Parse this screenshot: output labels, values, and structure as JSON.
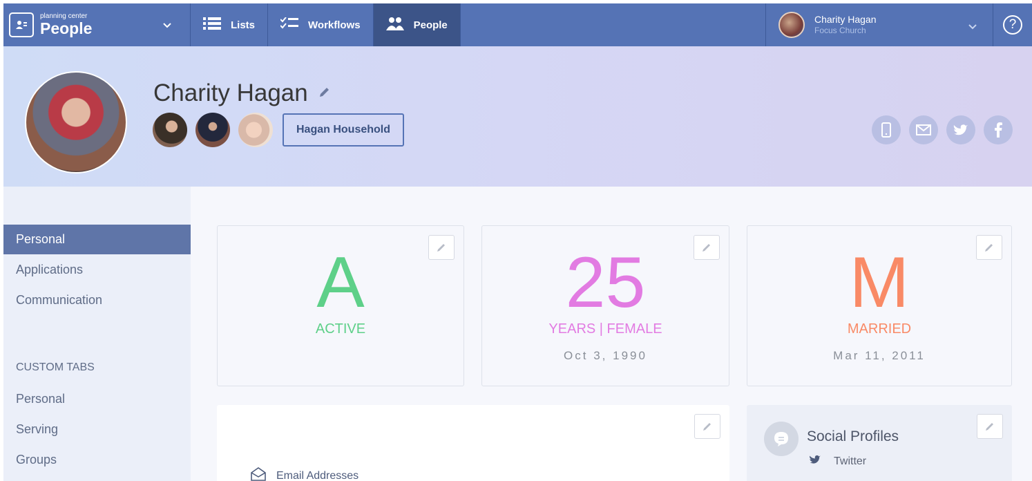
{
  "brand": {
    "small": "planning center",
    "big": "People"
  },
  "nav": {
    "tabs": [
      {
        "label": "Lists",
        "icon": "list-icon"
      },
      {
        "label": "Workflows",
        "icon": "checklist-icon"
      },
      {
        "label": "People",
        "icon": "people-icon",
        "active": true
      }
    ]
  },
  "user": {
    "name": "Charity Hagan",
    "org": "Focus Church"
  },
  "help": {
    "glyph": "?"
  },
  "profile": {
    "name": "Charity Hagan",
    "household_label": "Hagan Household",
    "social_icons": [
      "phone-icon",
      "email-icon",
      "twitter-icon",
      "facebook-icon"
    ]
  },
  "sidebar": {
    "items": [
      "Personal",
      "Applications",
      "Communication"
    ],
    "custom_heading": "CUSTOM TABS",
    "custom_items": [
      "Personal",
      "Serving",
      "Groups"
    ]
  },
  "cards": {
    "status": {
      "letter": "A",
      "label": "ACTIVE"
    },
    "age": {
      "letter": "25",
      "label": "YEARS | FEMALE",
      "sub": "Oct 3, 1990"
    },
    "marital": {
      "letter": "M",
      "label": "MARRIED",
      "sub": "Mar 11, 2011"
    }
  },
  "contact": {
    "email_label": "Email Addresses"
  },
  "social_profiles": {
    "title": "Social Profiles",
    "twitter_label": "Twitter"
  },
  "colors": {
    "nav": "#5573b5",
    "active": "#5ed089",
    "age": "#e27be2",
    "married": "#f98a66"
  }
}
